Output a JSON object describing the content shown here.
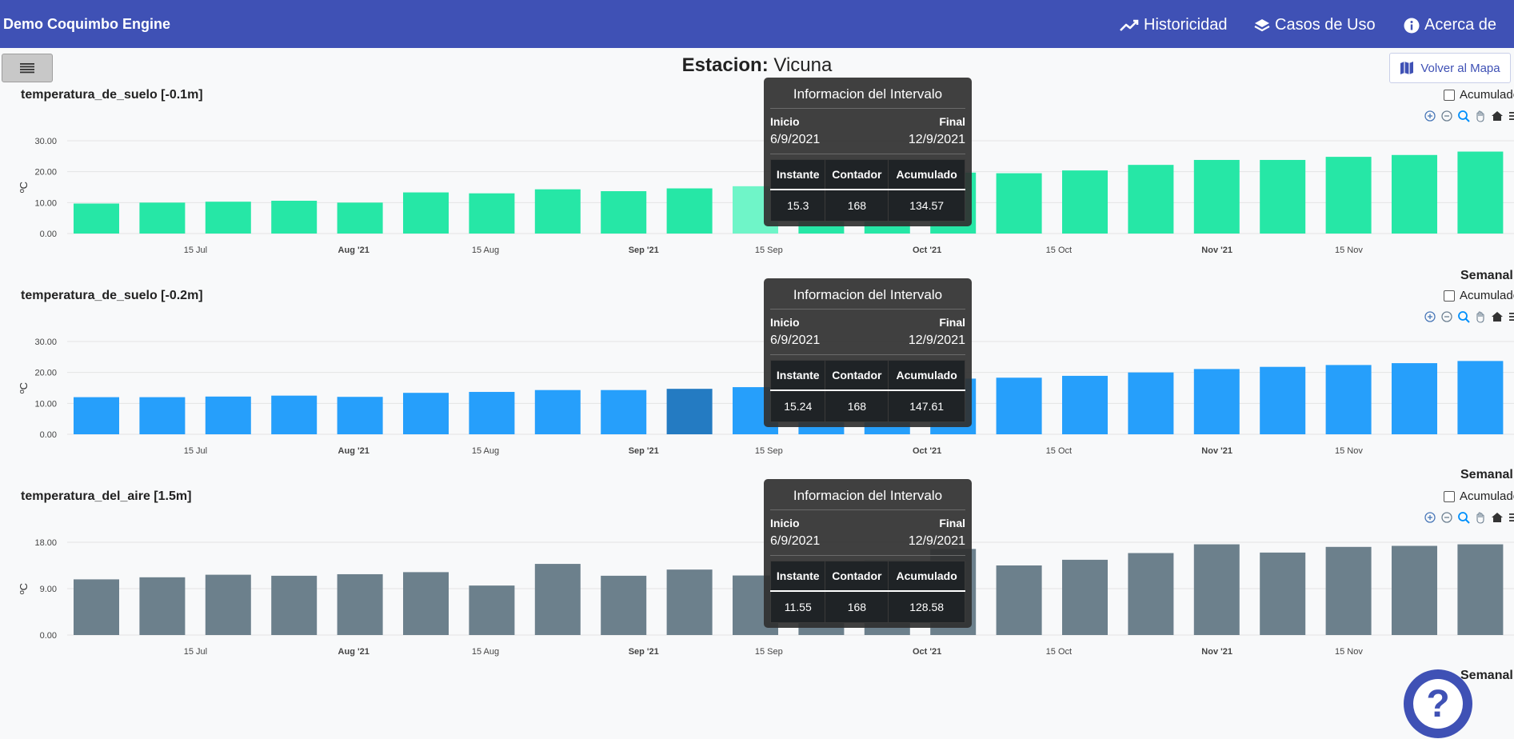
{
  "navbar": {
    "brand": "Demo Coquimbo Engine",
    "items": [
      {
        "label": "Historicidad",
        "icon": "trending-up-icon"
      },
      {
        "label": "Casos de Uso",
        "icon": "layers-icon"
      },
      {
        "label": "Acerca de",
        "icon": "info-icon"
      }
    ],
    "color": "#3f51b5"
  },
  "menu_button": {
    "icon": "hamburger-menu-icon"
  },
  "station": {
    "label": "Estacion:",
    "name": "Vicuna"
  },
  "map_button": {
    "label": "Volver al Mapa",
    "icon": "map-icon"
  },
  "help_button": {
    "icon": "question-mark-icon",
    "label": "?"
  },
  "toolbar_icons": [
    "zoom-in-icon",
    "zoom-out-icon",
    "zoom-selection-icon",
    "pan-hand-icon",
    "home-reset-icon",
    "menu-icon"
  ],
  "charts": [
    {
      "title": "temperatura_de_suelo [-0.1m]",
      "accumulated_label": "Acumulado",
      "period_label": "Semanal",
      "tooltip": {
        "title": "Informacion del Intervalo",
        "start_label": "Inicio",
        "end_label": "Final",
        "start": "6/9/2021",
        "end": "12/9/2021",
        "headers": [
          "Instante",
          "Contador",
          "Acumulado"
        ],
        "values": [
          "15.3",
          "168",
          "134.57"
        ]
      }
    },
    {
      "title": "temperatura_de_suelo [-0.2m]",
      "accumulated_label": "Acumulado",
      "period_label": "Semanal",
      "tooltip": {
        "title": "Informacion del Intervalo",
        "start_label": "Inicio",
        "end_label": "Final",
        "start": "6/9/2021",
        "end": "12/9/2021",
        "headers": [
          "Instante",
          "Contador",
          "Acumulado"
        ],
        "values": [
          "15.24",
          "168",
          "147.61"
        ]
      }
    },
    {
      "title": "temperatura_del_aire [1.5m]",
      "accumulated_label": "Acumulado",
      "period_label": "Semanal",
      "tooltip": {
        "title": "Informacion del Intervalo",
        "start_label": "Inicio",
        "end_label": "Final",
        "start": "6/9/2021",
        "end": "12/9/2021",
        "headers": [
          "Instante",
          "Contador",
          "Acumulado"
        ],
        "values": [
          "11.55",
          "168",
          "128.58"
        ]
      }
    }
  ],
  "chart_data": [
    {
      "type": "bar",
      "ylabel": "ºC",
      "ylim": [
        0,
        30
      ],
      "yticks": [
        "0.00",
        "10.00",
        "20.00",
        "30.00"
      ],
      "xticks": [
        {
          "label": "15 Jul",
          "bold": false,
          "week": 1.85
        },
        {
          "label": "Aug '21",
          "bold": true,
          "week": 4.25
        },
        {
          "label": "15 Aug",
          "bold": false,
          "week": 6.25
        },
        {
          "label": "Sep '21",
          "bold": true,
          "week": 8.65
        },
        {
          "label": "15 Sep",
          "bold": false,
          "week": 10.55
        },
        {
          "label": "Oct '21",
          "bold": true,
          "week": 12.95
        },
        {
          "label": "15 Oct",
          "bold": false,
          "week": 14.95
        },
        {
          "label": "Nov '21",
          "bold": true,
          "week": 17.35
        },
        {
          "label": "15 Nov",
          "bold": false,
          "week": 19.35
        }
      ],
      "color": "#26e7a6",
      "highlight_color": "#6ff5c8",
      "highlight_index": 10,
      "values": [
        9.7,
        10.0,
        10.3,
        10.6,
        10.0,
        13.3,
        13.0,
        14.3,
        13.7,
        14.6,
        15.3,
        16.0,
        17.0,
        19.7,
        19.5,
        20.4,
        22.2,
        23.8,
        23.8,
        24.8,
        25.4,
        26.5
      ]
    },
    {
      "type": "bar",
      "ylabel": "ºC",
      "ylim": [
        0,
        30
      ],
      "yticks": [
        "0.00",
        "10.00",
        "20.00",
        "30.00"
      ],
      "xticks": [
        {
          "label": "15 Jul",
          "bold": false,
          "week": 1.85
        },
        {
          "label": "Aug '21",
          "bold": true,
          "week": 4.25
        },
        {
          "label": "15 Aug",
          "bold": false,
          "week": 6.25
        },
        {
          "label": "Sep '21",
          "bold": true,
          "week": 8.65
        },
        {
          "label": "15 Sep",
          "bold": false,
          "week": 10.55
        },
        {
          "label": "Oct '21",
          "bold": true,
          "week": 12.95
        },
        {
          "label": "15 Oct",
          "bold": false,
          "week": 14.95
        },
        {
          "label": "Nov '21",
          "bold": true,
          "week": 17.35
        },
        {
          "label": "15 Nov",
          "bold": false,
          "week": 19.35
        }
      ],
      "color": "#269ffb",
      "highlight_color": "#247bc2",
      "highlight_index": 9,
      "values": [
        12.0,
        12.0,
        12.2,
        12.5,
        12.1,
        13.4,
        13.7,
        14.3,
        14.3,
        14.7,
        15.24,
        16.0,
        17.0,
        18.0,
        18.3,
        18.9,
        20.0,
        21.1,
        21.8,
        22.4,
        23.0,
        23.7
      ]
    },
    {
      "type": "bar",
      "ylabel": "ºC",
      "ylim": [
        0,
        18
      ],
      "yticks": [
        "0.00",
        "9.00",
        "18.00"
      ],
      "xticks": [
        {
          "label": "15 Jul",
          "bold": false,
          "week": 1.85
        },
        {
          "label": "Aug '21",
          "bold": true,
          "week": 4.25
        },
        {
          "label": "15 Aug",
          "bold": false,
          "week": 6.25
        },
        {
          "label": "Sep '21",
          "bold": true,
          "week": 8.65
        },
        {
          "label": "15 Sep",
          "bold": false,
          "week": 10.55
        },
        {
          "label": "Oct '21",
          "bold": true,
          "week": 12.95
        },
        {
          "label": "15 Oct",
          "bold": false,
          "week": 14.95
        },
        {
          "label": "Nov '21",
          "bold": true,
          "week": 17.35
        },
        {
          "label": "15 Nov",
          "bold": false,
          "week": 19.35
        }
      ],
      "color": "#6c808c",
      "highlight_color": "#6c808c",
      "highlight_index": -1,
      "values": [
        10.8,
        11.2,
        11.7,
        11.5,
        11.8,
        12.2,
        9.6,
        13.8,
        11.5,
        12.7,
        11.55,
        13.5,
        14.5,
        16.7,
        13.5,
        14.6,
        15.9,
        17.6,
        16.0,
        17.1,
        17.3,
        17.6
      ]
    }
  ]
}
